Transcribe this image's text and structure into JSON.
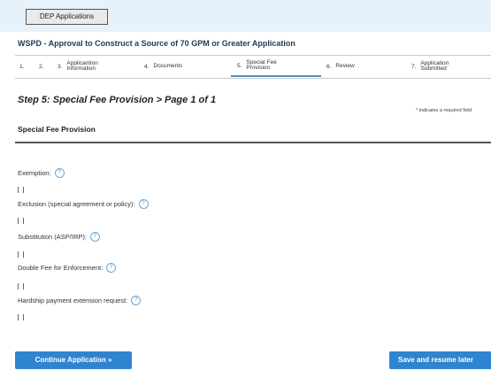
{
  "header": {
    "my_applications_label": "DEP Applications"
  },
  "application": {
    "title": "WSPD - Approval to Construct a Source of 70 GPM or Greater Application"
  },
  "steps": [
    {
      "num": "1.",
      "label": ""
    },
    {
      "num": "2.",
      "label": ""
    },
    {
      "num": "3.",
      "label": "Applicantion Information"
    },
    {
      "num": "4.",
      "label": "Documents"
    },
    {
      "num": "5.",
      "label": "Special Fee Provision"
    },
    {
      "num": "6.",
      "label": "Review"
    },
    {
      "num": "7.",
      "label": "Application Submitted"
    }
  ],
  "page": {
    "step_title": "Step 5: Special Fee Provision > Page 1 of 1",
    "required_note": "* indicates a required field",
    "section_title": "Special Fee Provision"
  },
  "fields": [
    {
      "label": "Exemption:"
    },
    {
      "label": "Exclusion (special agreement or policy):"
    },
    {
      "label": "Substitution (ASP/IRP):"
    },
    {
      "label": "Double Fee for Enforcement:"
    },
    {
      "label": "Hardship payment extension request:"
    }
  ],
  "icons": {
    "help": "help-icon",
    "continue": "chevron-down-icon"
  },
  "buttons": {
    "continue_label": "Continue Application »",
    "save_label": "Save and resume later"
  },
  "colors": {
    "accent": "#2f84cf",
    "topbar": "#e6f1f9"
  }
}
